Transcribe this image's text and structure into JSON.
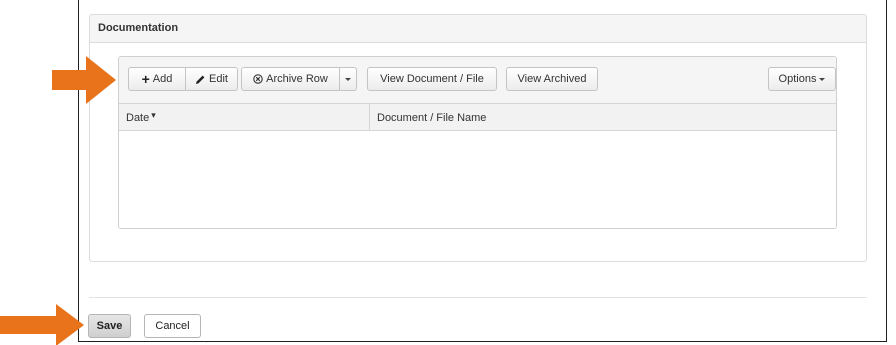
{
  "panel": {
    "title": "Documentation"
  },
  "toolbar": {
    "add_label": "Add",
    "edit_label": "Edit",
    "archive_row_label": "Archive Row",
    "view_document_label": "View Document / File",
    "view_archived_label": "View Archived",
    "options_label": "Options"
  },
  "grid": {
    "columns": [
      {
        "label": "Date",
        "sort_marker": "▾"
      },
      {
        "label": "Document / File Name"
      }
    ],
    "rows": []
  },
  "footer": {
    "save_label": "Save",
    "cancel_label": "Cancel"
  },
  "icons": {
    "add": "plus-icon",
    "edit": "pencil-icon",
    "archive": "circle-x-icon",
    "dropdown": "caret-down-icon",
    "annotation": "arrow-right-icon"
  },
  "colors": {
    "annotation_arrow": "#e8731a",
    "panel_header_bg": "#f5f5f5",
    "border": "#dcdcdc",
    "save_button_bg": "#d9d9d9"
  }
}
